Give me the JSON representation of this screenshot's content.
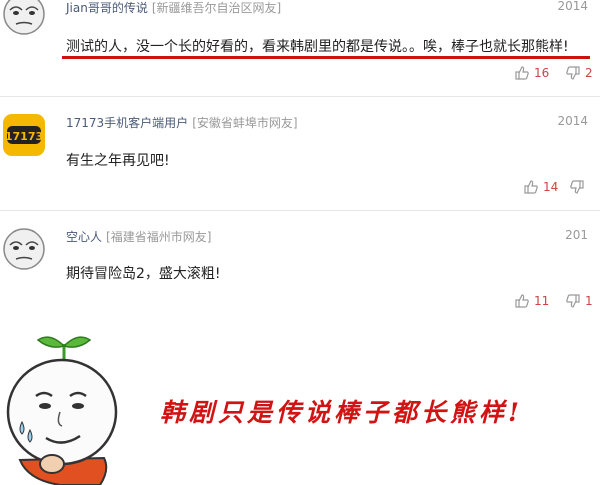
{
  "comments": [
    {
      "username": "Jian哥哥的传说",
      "location": "[新疆维吾尔自治区网友]",
      "year": "2014",
      "text": "测试的人，没一个长的好看的，看来韩剧里的都是传说。。唉，棒子也就长那熊样!",
      "likes": "16",
      "dislikes": "2",
      "avatar": "face-avatar"
    },
    {
      "username": "17173手机客户端用户",
      "location": "[安徽省蚌埠市网友]",
      "year": "2014",
      "text": "有生之年再见吧!",
      "likes": "14",
      "dislikes": "",
      "avatar": "17173-logo",
      "logo_text": "17173"
    },
    {
      "username": "空心人",
      "location": "[福建省福州市网友]",
      "year": "201",
      "text": "期待冒险岛2，盛大滚粗!",
      "likes": "11",
      "dislikes": "1",
      "avatar": "face-avatar"
    }
  ],
  "meme": {
    "caption": "韩剧只是传说棒子都长熊样!"
  },
  "colors": {
    "accent_red": "#cc1111",
    "logo_yellow": "#f5b800",
    "vote_red": "#cc4444"
  }
}
